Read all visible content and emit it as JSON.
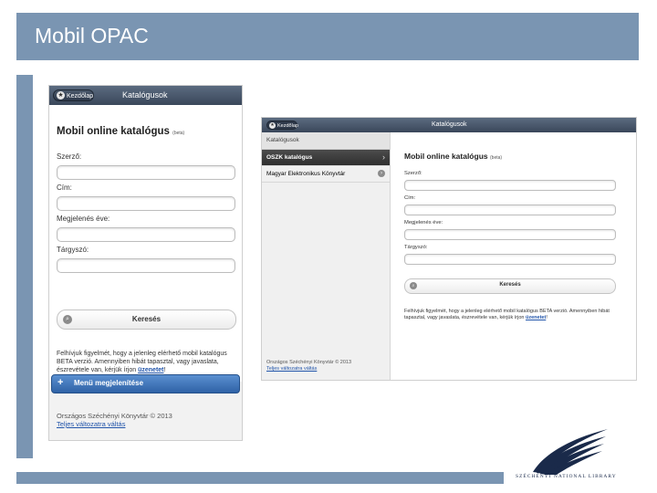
{
  "slide": {
    "title": "Mobil OPAC"
  },
  "phone": {
    "back_label": "Kezdőlap",
    "bar_title": "Katalógusok",
    "heading": "Mobil online katalógus",
    "beta": "(beta)",
    "fields": [
      {
        "label": "Szerző:",
        "value": ""
      },
      {
        "label": "Cím:",
        "value": ""
      },
      {
        "label": "Megjelenés éve:",
        "value": ""
      },
      {
        "label": "Tárgyszó:",
        "value": ""
      }
    ],
    "search_label": "Keresés",
    "notice_text": "Felhívjuk figyelmét, hogy a jelenleg elérhető mobil katalógus BETA verzió. Amennyiben hibát tapasztal, vagy javaslata, észrevétele van, kérjük írjon",
    "notice_link": "üzenetet",
    "notice_end": "!",
    "menu_label": "Menü megjelenítése",
    "footer_line1": "Országos Széchényi Könyvtár © 2013",
    "footer_link": "Teljes változatra váltás"
  },
  "tablet": {
    "back_label": "Kezdőlap",
    "bar_title": "Katalógusok",
    "sidebar_title": "Katalógusok",
    "sidebar_items": [
      {
        "label": "OSZK katalógus",
        "active": true
      },
      {
        "label": "Magyar Elektronikus Könyvtár",
        "active": false
      }
    ],
    "footer_line1": "Országos Széchényi Könyvtár © 2013",
    "footer_link": "Teljes változatra váltás",
    "heading": "Mobil online katalógus",
    "beta": "(beta)",
    "fields": [
      {
        "label": "Szerző:",
        "value": ""
      },
      {
        "label": "Cím:",
        "value": ""
      },
      {
        "label": "Megjelenés éve:",
        "value": ""
      },
      {
        "label": "Tárgyszó:",
        "value": ""
      }
    ],
    "search_label": "Keresés",
    "notice_text": "Felhívjuk figyelmét, hogy a jelenleg elérhető mobil katalógus BETA verzió. Amennyiben hibát tapasztal, vagy javaslata, észrevétele van, kérjük írjon",
    "notice_link": "üzenetet",
    "notice_end": "!"
  },
  "logo": {
    "text": "SZÉCHÉNYI NATIONAL LIBRARY"
  },
  "colors": {
    "slide_accent": "#7a95b2",
    "link": "#2255aa",
    "menu_button": "#3a70b8"
  }
}
